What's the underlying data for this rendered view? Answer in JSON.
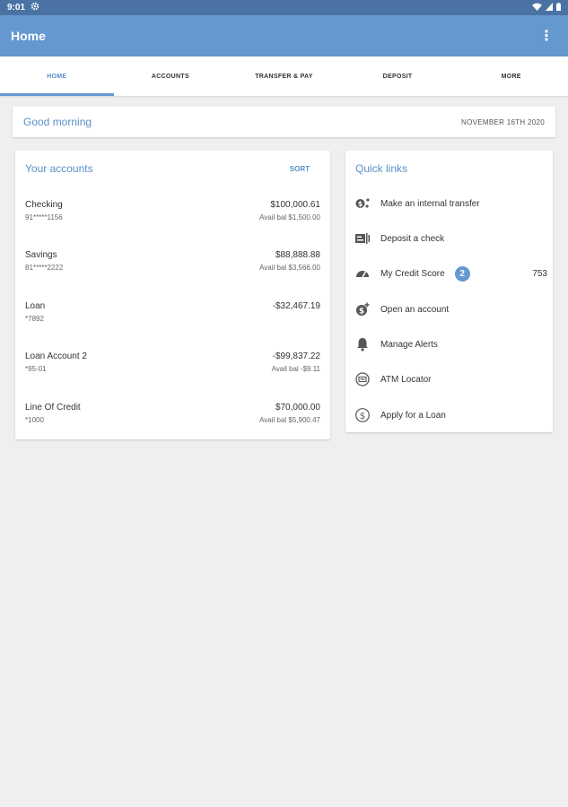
{
  "status_bar": {
    "time": "9:01"
  },
  "app_bar": {
    "title": "Home",
    "menu_label": "⋮"
  },
  "tabs": [
    {
      "label": "HOME",
      "active": true
    },
    {
      "label": "ACCOUNTS",
      "active": false
    },
    {
      "label": "TRANSFER & PAY",
      "active": false
    },
    {
      "label": "DEPOSIT",
      "active": false
    },
    {
      "label": "MORE",
      "active": false
    }
  ],
  "greeting": {
    "text": "Good morning",
    "date": "NOVEMBER 16TH 2020"
  },
  "accounts": {
    "title": "Your accounts",
    "sort_label": "SORT",
    "items": [
      {
        "name": "Checking",
        "number": "91*****1156",
        "balance": "$100,000.61",
        "avail": "Avail bal $1,500.00"
      },
      {
        "name": "Savings",
        "number": "81*****2222",
        "balance": "$88,888.88",
        "avail": "Avail bal $3,566.00"
      },
      {
        "name": "Loan",
        "number": "*7892",
        "balance": "-$32,467.19",
        "avail": ""
      },
      {
        "name": "Loan Account 2",
        "number": "*95-01",
        "balance": "-$99,837.22",
        "avail": "Avail bal -$9.11"
      },
      {
        "name": "Line Of Credit",
        "number": "*1000",
        "balance": "$70,000.00",
        "avail": "Avail bal $5,900.47"
      }
    ]
  },
  "quick_links": {
    "title": "Quick links",
    "items": [
      {
        "label": "Make an internal transfer",
        "icon": "transfer-icon"
      },
      {
        "label": "Deposit a check",
        "icon": "check-deposit-icon"
      },
      {
        "label": "My Credit Score",
        "icon": "gauge-icon",
        "badge": "2",
        "score": "753"
      },
      {
        "label": "Open an account",
        "icon": "open-account-icon"
      },
      {
        "label": "Manage Alerts",
        "icon": "bell-icon"
      },
      {
        "label": "ATM Locator",
        "icon": "atm-icon"
      },
      {
        "label": "Apply for a Loan",
        "icon": "dollar-icon"
      }
    ]
  },
  "colors": {
    "primary": "#6598cf",
    "status_bar": "#4a73a3",
    "accent_text": "#5a8fc7",
    "background": "#efefef"
  }
}
